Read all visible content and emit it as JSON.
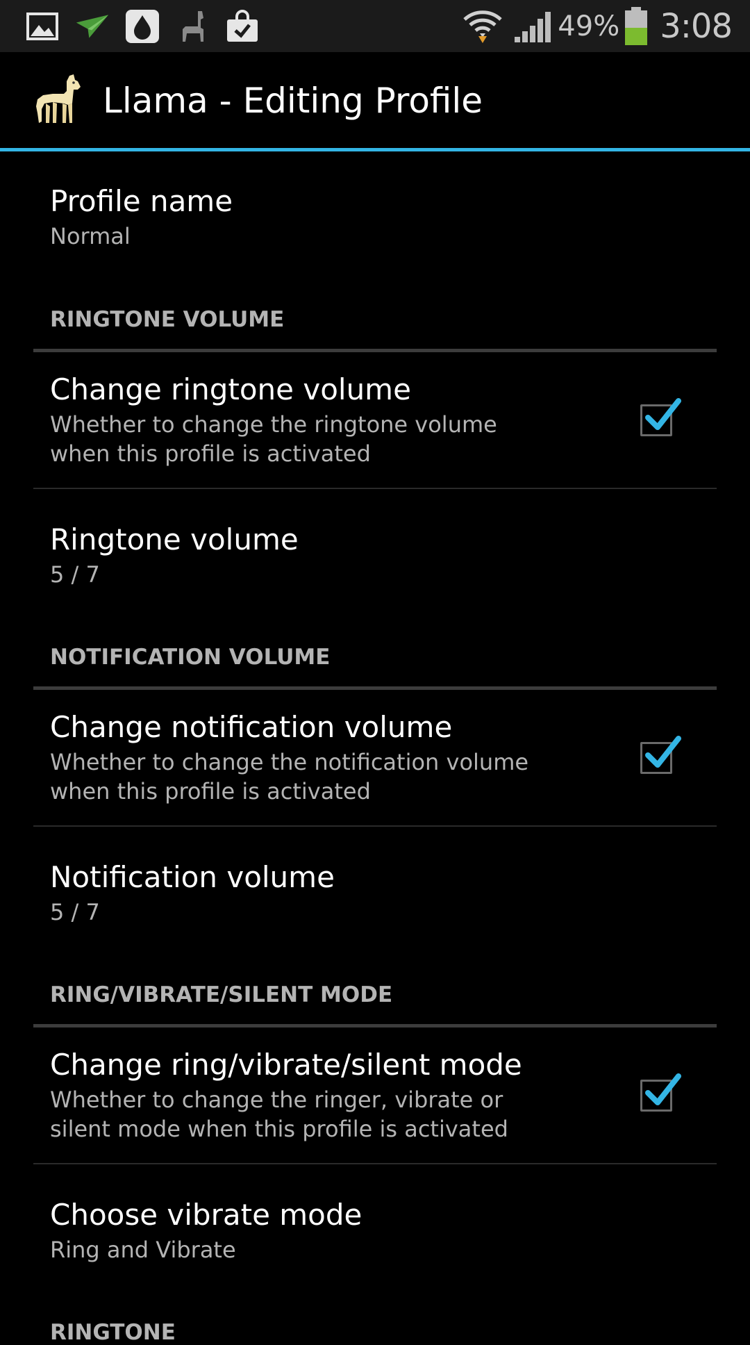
{
  "status_bar": {
    "battery_percent": "49%",
    "time": "3:08",
    "icons": [
      "gallery-icon",
      "airplane-message-icon",
      "water-drop-app-icon",
      "llama-icon",
      "shopping-bag-icon",
      "wifi-icon",
      "signal-icon",
      "battery-icon"
    ]
  },
  "action_bar": {
    "title": "Llama - Editing Profile"
  },
  "colors": {
    "accent": "#33b5e5",
    "battery_fill": "#7cbb2f",
    "text_secondary": "#b4b4b4"
  },
  "profile": {
    "title": "Profile name",
    "value": "Normal"
  },
  "categories": [
    {
      "label": "RINGTONE VOLUME",
      "toggle": {
        "title": "Change ringtone volume",
        "summary": "Whether to change the ringtone volume when this profile is activated",
        "checked": true
      },
      "setting": {
        "title": "Ringtone volume",
        "value": "5 / 7"
      }
    },
    {
      "label": "NOTIFICATION VOLUME",
      "toggle": {
        "title": "Change notification volume",
        "summary": "Whether to change the notification volume when this profile is activated",
        "checked": true
      },
      "setting": {
        "title": "Notification volume",
        "value": "5 / 7"
      }
    },
    {
      "label": "RING/VIBRATE/SILENT MODE",
      "toggle": {
        "title": "Change ring/vibrate/silent mode",
        "summary": "Whether to change the ringer, vibrate or silent mode when this profile is activated",
        "checked": true
      },
      "setting": {
        "title": "Choose vibrate mode",
        "value": "Ring and Vibrate"
      }
    },
    {
      "label": "RINGTONE"
    }
  ]
}
